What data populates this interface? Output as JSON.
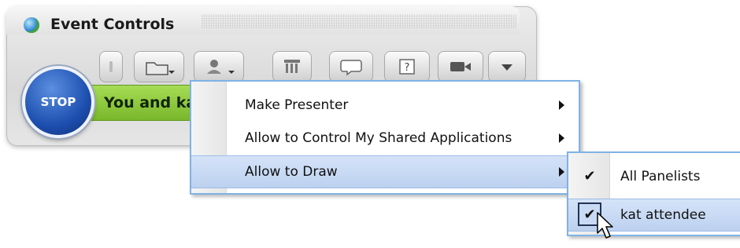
{
  "window": {
    "title": "Event Controls",
    "stop_label": "STOP",
    "status_text": "You and ka"
  },
  "toolbar": {
    "icons": [
      "info-icon",
      "folder-share-icon",
      "attendee-icon",
      "panelists-icon",
      "chat-icon",
      "help-icon",
      "camera-icon",
      "dropdown-icon"
    ]
  },
  "context_menu": {
    "items": [
      {
        "label": "Make Presenter",
        "has_submenu": true
      },
      {
        "label": "Allow to Control My Shared Applications",
        "has_submenu": true
      },
      {
        "label": "Allow to Draw",
        "has_submenu": true,
        "highlighted": true
      }
    ]
  },
  "submenu": {
    "items": [
      {
        "label": "All Panelists",
        "checked": true
      },
      {
        "label": "kat attendee",
        "checked": true,
        "highlighted": true
      }
    ]
  },
  "colors": {
    "status_green": "#8cc63f",
    "stop_blue": "#1d4fb0",
    "menu_border": "#7fb2e6",
    "highlight": "#c9daf4"
  }
}
